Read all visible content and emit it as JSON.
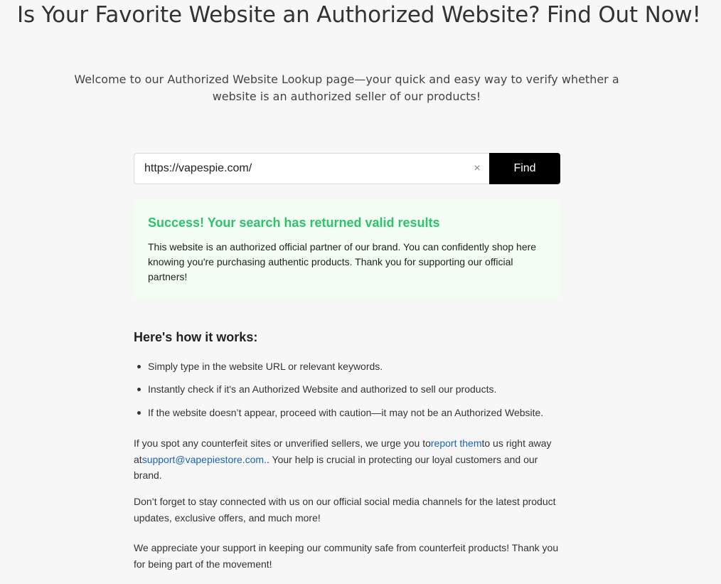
{
  "page": {
    "title": "Is Your Favorite Website an Authorized Website? Find Out Now!",
    "intro": "Welcome to our Authorized Website Lookup page—your quick and easy way to verify whether a website is an authorized seller of our products!"
  },
  "search": {
    "value": "https://vapespie.com/",
    "clear_icon": "×",
    "find_label": "Find"
  },
  "result": {
    "title": "Success! Your search has returned valid results",
    "text": "This website is an authorized official partner of our brand. You can confidently shop here knowing you're purchasing authentic products. Thank you for supporting our official partners!",
    "title_color": "#2cc36b",
    "background_color": "#f3fdf3"
  },
  "how_it_works": {
    "title": "Here's how it works:",
    "steps": [
      "Simply type in the website URL or relevant keywords.",
      "Instantly check if it's an Authorized Website and authorized to sell our products.",
      "If the website doesn’t appear, proceed with caution—it may not be an Authorized Website."
    ]
  },
  "report": {
    "text_before_link": "If you spot any counterfeit sites or unverified sellers, we urge you to",
    "report_link": "report them",
    "text_after_link": "to us right away at",
    "email_link": "support@vapepiestore.com.",
    "text_end": ". Your help is crucial in protecting our loyal customers and our brand."
  },
  "social": {
    "text": "Don’t forget to stay connected with us on our official social media channels for the latest product updates, exclusive offers, and much more!"
  },
  "closing": {
    "text": "We appreciate your support in keeping our community safe from counterfeit products! Thank you for being part of the movement!"
  },
  "colors": {
    "link": "#1a64b4",
    "button_bg": "#000000",
    "page_bg": "#f7f7f7"
  }
}
